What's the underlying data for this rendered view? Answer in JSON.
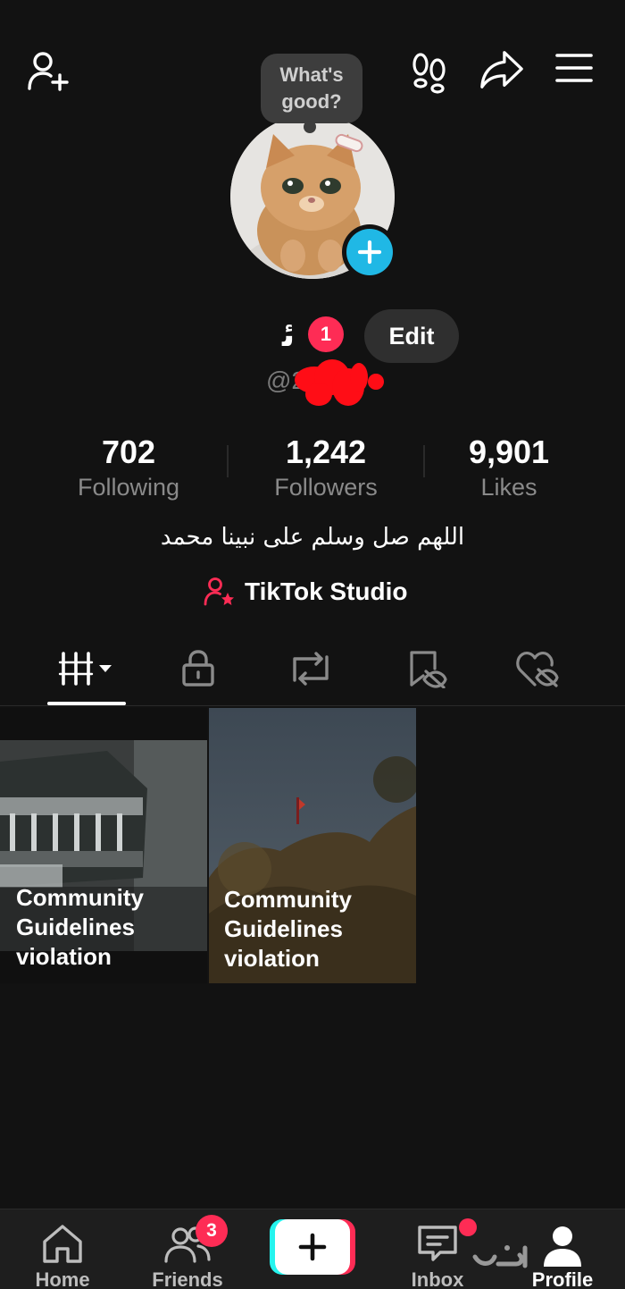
{
  "bubble": {
    "line1": "What's",
    "line2": "good?"
  },
  "profile": {
    "name": "ﺋ",
    "name_badge": "1",
    "edit_label": "Edit",
    "handle": "@22",
    "bio": "اللهم صل وسلم على نبينا محمد"
  },
  "stats": {
    "following": {
      "value": "702",
      "label": "Following"
    },
    "followers": {
      "value": "1,242",
      "label": "Followers"
    },
    "likes": {
      "value": "9,901",
      "label": "Likes"
    }
  },
  "studio": {
    "label": "TikTok Studio"
  },
  "tabs": [
    {
      "icon": "grid-icon"
    },
    {
      "icon": "lock-icon"
    },
    {
      "icon": "repost-icon"
    },
    {
      "icon": "saved-hidden-icon"
    },
    {
      "icon": "liked-hidden-icon"
    }
  ],
  "videos": [
    {
      "label_line1": "Community",
      "label_line2": "Guidelines",
      "label_line3": "violation"
    },
    {
      "label_line1": "Community",
      "label_line2": "Guidelines",
      "label_line3": "violation"
    }
  ],
  "nav": {
    "home": "Home",
    "friends": "Friends",
    "friends_badge": "3",
    "inbox": "Inbox",
    "profile": "Profile"
  },
  "colors": {
    "accent_red": "#fe2c55",
    "accent_cyan": "#20b8e5",
    "background": "#121212"
  }
}
